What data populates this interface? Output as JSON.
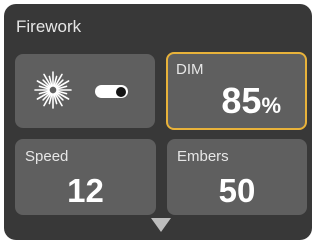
{
  "panel": {
    "title": "Firework"
  },
  "toggle_tile": {
    "icon": "firework-burst-icon",
    "switch_state": "on"
  },
  "dim": {
    "label": "DIM",
    "value": "85",
    "unit": "%"
  },
  "speed": {
    "label": "Speed",
    "value": "12"
  },
  "embers": {
    "label": "Embers",
    "value": "50"
  },
  "more": {
    "icon": "triangle-down-icon"
  },
  "colors": {
    "panel_bg": "#383838",
    "tile_bg": "#5f5f5f",
    "selected_border": "#e8b23a",
    "text": "#ffffff"
  }
}
